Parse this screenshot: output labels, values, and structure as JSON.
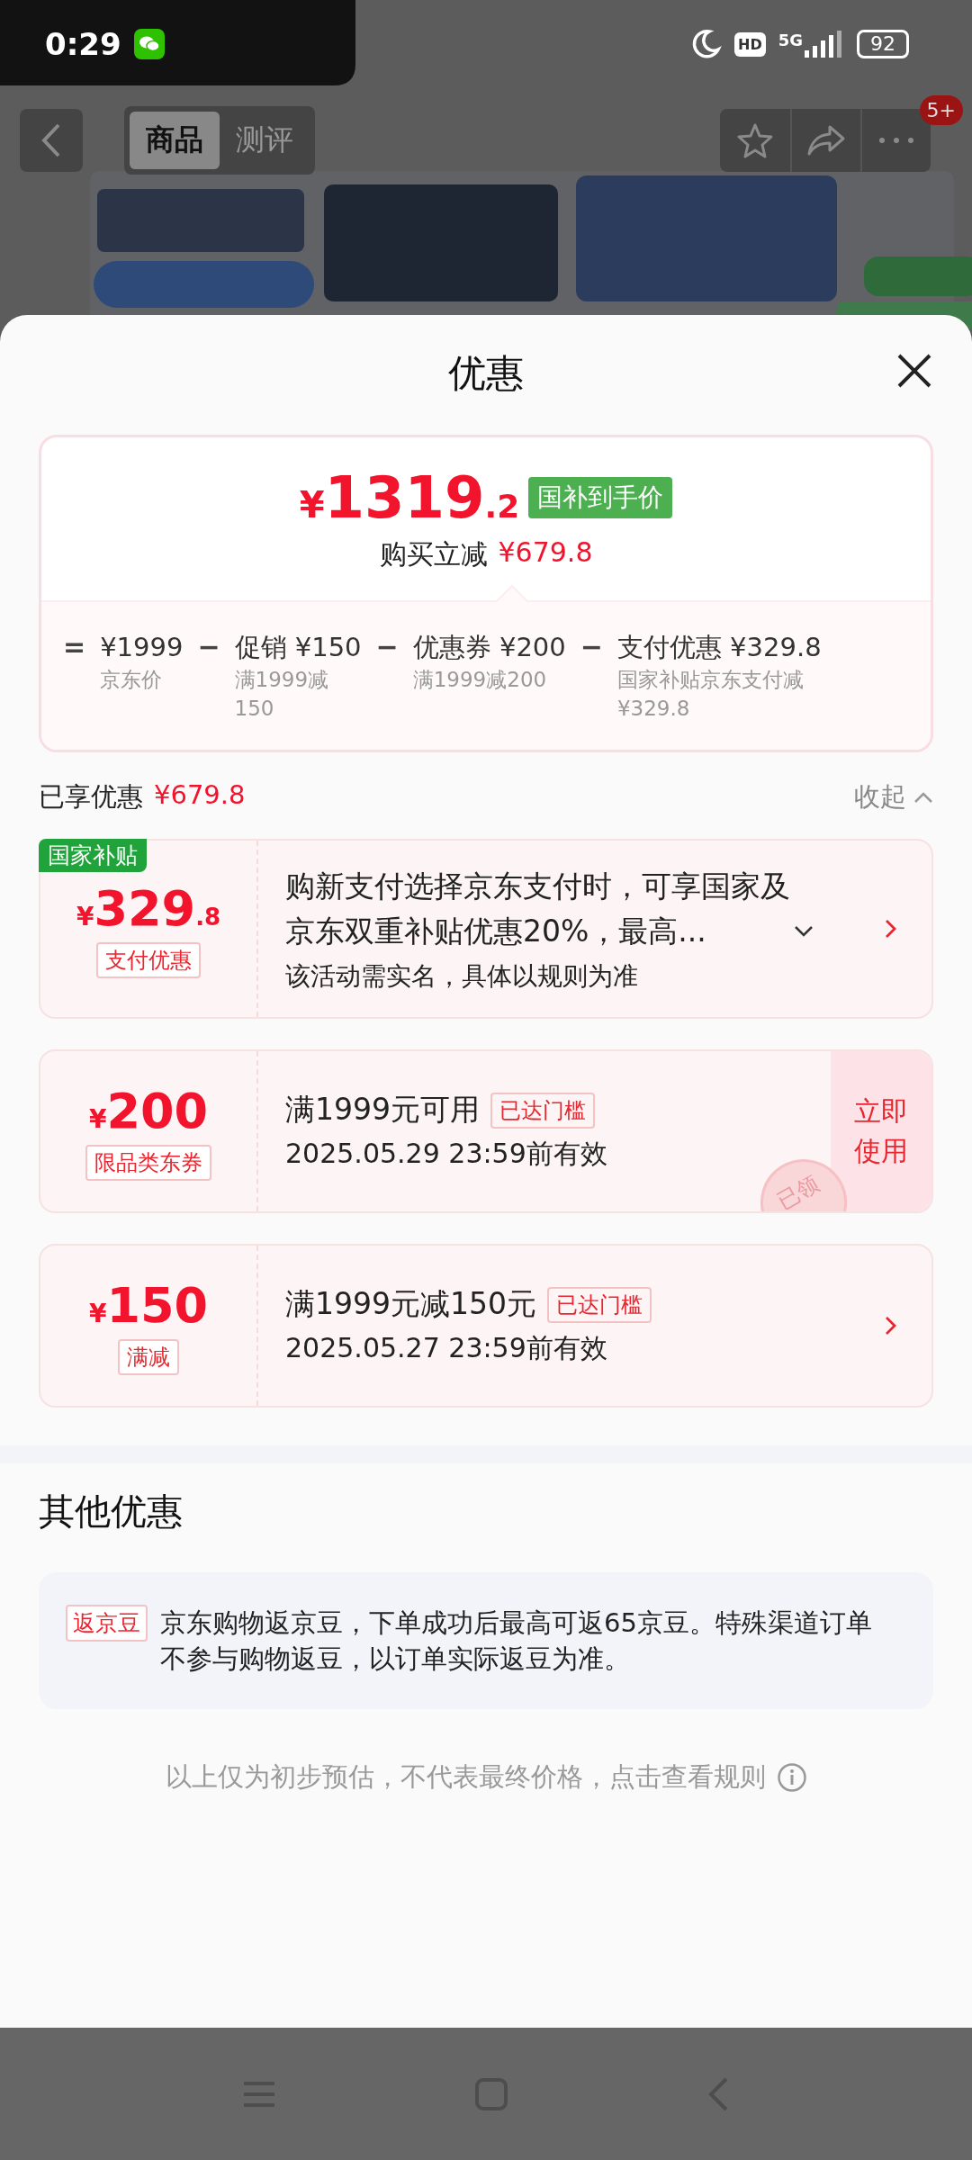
{
  "status_bar": {
    "time": "0:29",
    "hd": "HD",
    "network": "5G",
    "battery": "92"
  },
  "header": {
    "tabs": [
      {
        "label": "商品",
        "selected": true
      },
      {
        "label": "测评",
        "selected": false
      }
    ],
    "badge": "5+"
  },
  "sheet": {
    "title": "优惠",
    "summary": {
      "currency": "¥",
      "price_int": "1319",
      "price_dec": ".2",
      "price_tag": "国补到手价",
      "cut_label": "购买立减",
      "cut_amount": "¥679.8",
      "breakdown": [
        {
          "op": "=",
          "amount": "¥1999",
          "note": "京东价"
        },
        {
          "op": "−",
          "label": "促销",
          "amount": "¥150",
          "note": "满1999减150"
        },
        {
          "op": "−",
          "label": "优惠券",
          "amount": "¥200",
          "note": "满1999减200"
        },
        {
          "op": "−",
          "label": "支付优惠",
          "amount": "¥329.8",
          "note": "国家补贴京东支付减¥329.8"
        }
      ]
    },
    "enjoyed": {
      "label": "已享优惠",
      "amount": "¥679.8",
      "toggle": "收起",
      "expanded": true
    },
    "offers": [
      {
        "kind": "subsidy",
        "corner_tag": "国家补贴",
        "currency": "¥",
        "amount": "329",
        "decimal": ".8",
        "type_label": "支付优惠",
        "description": "购新支付选择京东支付时，可享国家及京东双重补贴优惠20%，最高...",
        "note": "该活动需实名，具体以规则为准",
        "action": {
          "kind": "arrow"
        },
        "claimed": false
      },
      {
        "kind": "coupon",
        "currency": "¥",
        "amount": "200",
        "type_label": "限品类东券",
        "title": "满1999元可用",
        "badge": "已达门槛",
        "validity": "2025.05.29 23:59前有效",
        "action": {
          "kind": "button",
          "label": "立即使用"
        },
        "claimed": true,
        "stamp": "已领"
      },
      {
        "kind": "coupon",
        "currency": "¥",
        "amount": "150",
        "type_label": "满减",
        "title": "满1999元减150元",
        "badge": "已达门槛",
        "validity": "2025.05.27 23:59前有效",
        "action": {
          "kind": "arrow"
        },
        "claimed": false
      }
    ],
    "other": {
      "title": "其他优惠",
      "items": [
        {
          "tag": "返京豆",
          "text": "京东购物返京豆，下单成功后最高可返65京豆。特殊渠道订单不参与购物返豆，以订单实际返豆为准。"
        }
      ]
    },
    "footer": "以上仅为初步预估，不代表最终价格，点击查看规则"
  }
}
